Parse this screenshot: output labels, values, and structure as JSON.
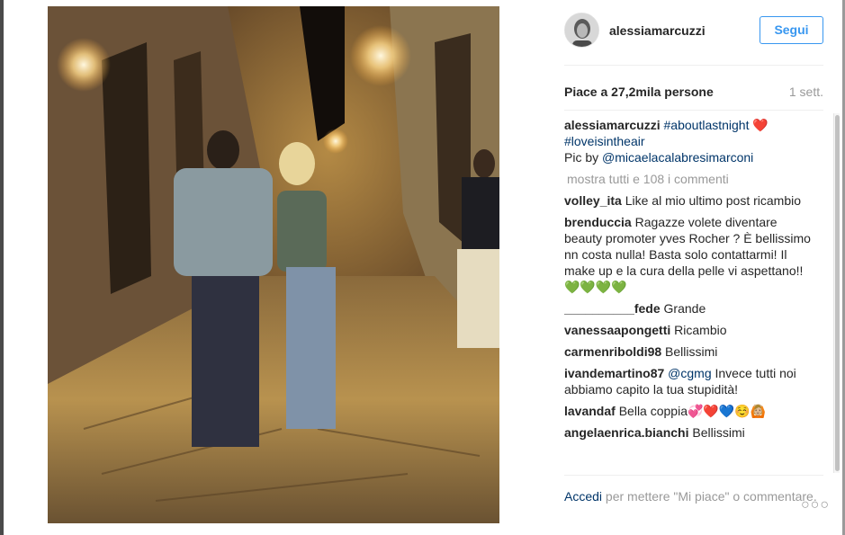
{
  "post": {
    "username": "alessiamarcuzzi",
    "follow_label": "Segui",
    "likes": "Piace a 27,2mila persone",
    "time": "1 sett."
  },
  "caption": {
    "username": "alessiamarcuzzi",
    "tag1": "#aboutlastnight",
    "emoji": "❤️",
    "tag2": "#loveisintheair",
    "pic_by": "Pic by",
    "mention": "@micaelacalabresimarconi"
  },
  "more_comments": "mostra tutti e 108 i commenti",
  "comments": [
    {
      "user": "volley_ita",
      "text": "Like al mio ultimo post ricambio"
    },
    {
      "user": "brenduccia",
      "text": "Ragazze volete diventare beauty promoter yves Rocher ? È bellissimo nn costa nulla! Basta solo contattarmi! Il make up e la cura della pelle vi aspettano!! 💚💚💚💚"
    },
    {
      "user": "__________fede",
      "text": "Grande"
    },
    {
      "user": "vanessaapongetti",
      "text": "Ricambio"
    },
    {
      "user": "carmenriboldi98",
      "text": "Bellissimi"
    },
    {
      "user": "ivandemartino87",
      "mention": "@cgmg",
      "text": "Invece tutti noi abbiamo capito la tua stupidità!"
    },
    {
      "user": "lavandaf",
      "text": "Bella coppia💞❤️💙☺️🙆🏼"
    },
    {
      "user": "angelaenrica.bianchi",
      "text": "Bellissimi"
    }
  ],
  "footer": {
    "login": "Accedi",
    "rest": "per mettere \"Mi piace\" o commentare.",
    "more_icon": "ellipsis-icon"
  }
}
